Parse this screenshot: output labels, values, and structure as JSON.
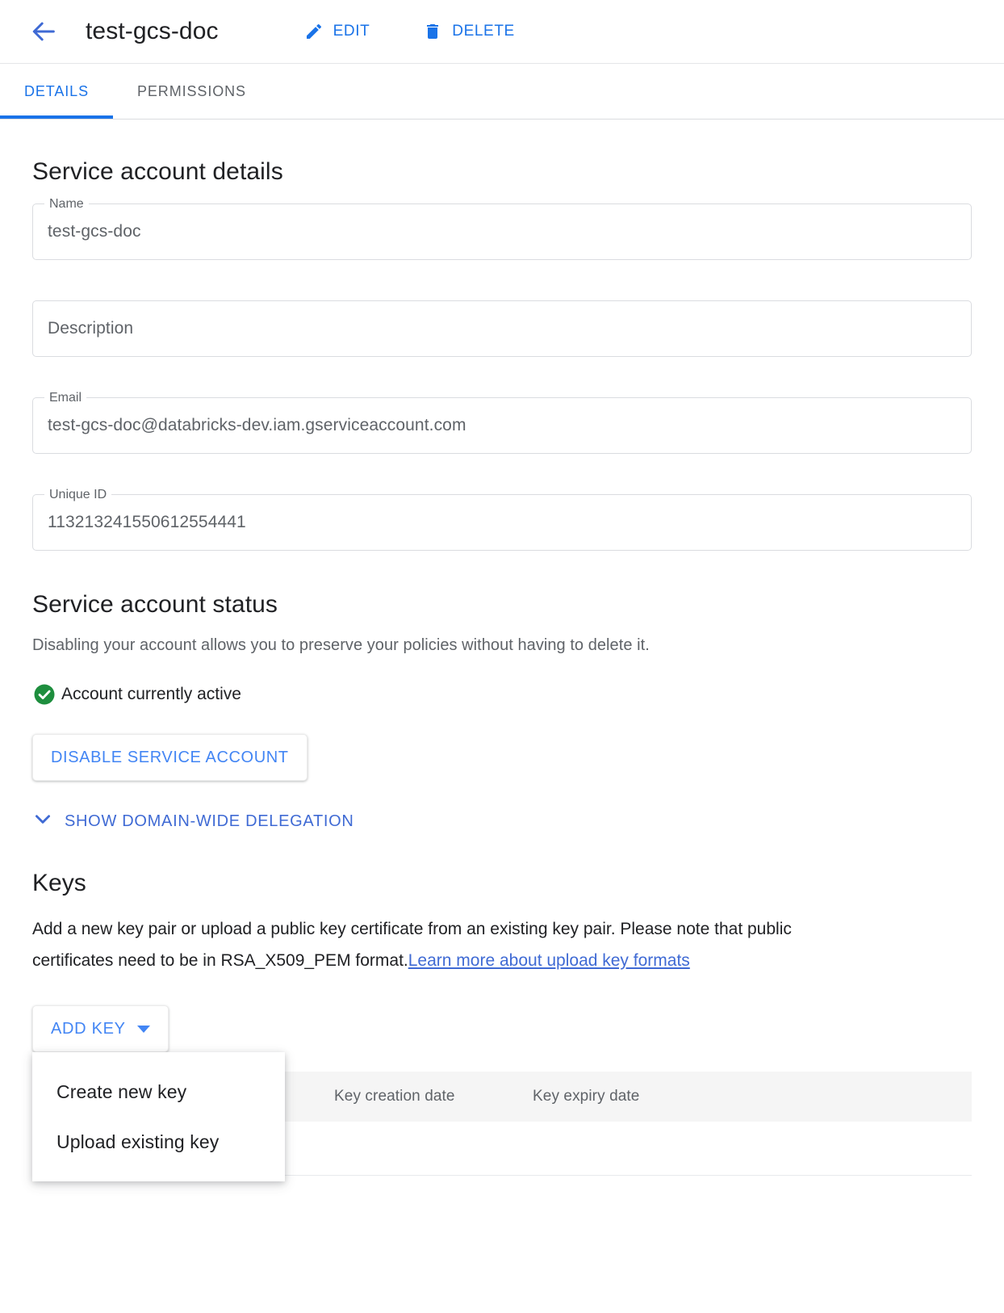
{
  "header": {
    "back_icon": "arrow-left-icon",
    "title": "test-gcs-doc",
    "edit_label": "EDIT",
    "edit_icon": "pencil-icon",
    "delete_label": "DELETE",
    "delete_icon": "trash-icon"
  },
  "tabs": [
    {
      "label": "DETAILS",
      "active": true
    },
    {
      "label": "PERMISSIONS",
      "active": false
    }
  ],
  "details": {
    "section_title": "Service account details",
    "fields": [
      {
        "legend": "Name",
        "value": "test-gcs-doc"
      },
      {
        "legend": "",
        "placeholder": "Description",
        "value": ""
      },
      {
        "legend": "Email",
        "value": "test-gcs-doc@databricks-dev.iam.gserviceaccount.com"
      },
      {
        "legend": "Unique ID",
        "value": "113213241550612554441"
      }
    ]
  },
  "status": {
    "section_title": "Service account status",
    "description": "Disabling your account allows you to preserve your policies without having to delete it.",
    "state_label": "Account currently active",
    "state_icon": "check-circle-icon",
    "state_color": "#1e8e3e",
    "disable_button": "DISABLE SERVICE ACCOUNT",
    "delegation_label": "SHOW DOMAIN-WIDE DELEGATION",
    "delegation_icon": "chevron-down-icon"
  },
  "keys": {
    "section_title": "Keys",
    "description_part1": "Add a new key pair or upload a public key certificate from an existing key pair. Please note that public certificates need to be in RSA_X509_PEM format.",
    "description_link": "Learn more about upload key formats",
    "add_key_label": "ADD KEY",
    "add_key_caret": "caret-down-icon",
    "menu_items": [
      {
        "label": "Create new key"
      },
      {
        "label": "Upload existing key"
      }
    ],
    "table": {
      "columns": [
        "",
        "Key creation date",
        "Key expiry date"
      ],
      "rows": []
    }
  },
  "colors": {
    "accent": "#1a73e8",
    "link": "#3f6ad4",
    "success": "#1e8e3e",
    "text": "#202124",
    "muted": "#5f6368"
  }
}
